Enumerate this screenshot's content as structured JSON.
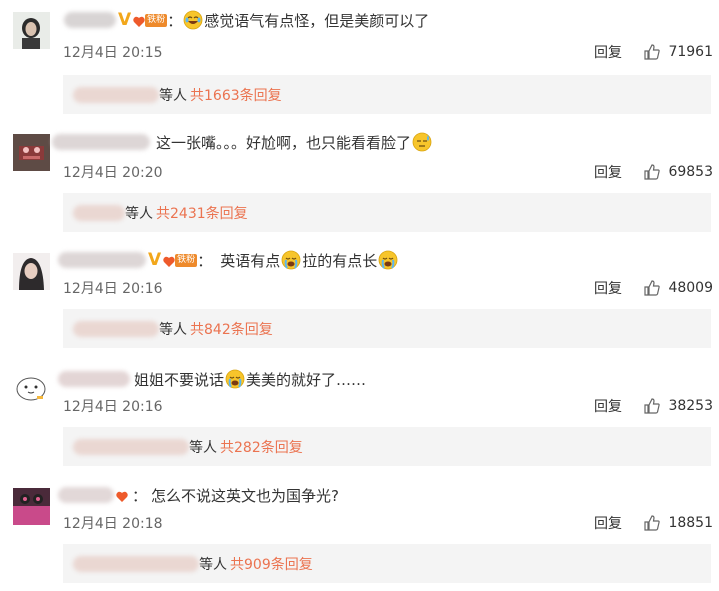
{
  "comments": [
    {
      "text": "：",
      "content": [
        "感觉语气有点怪，但是美颜可以了"
      ],
      "time": "12月4日 20:15",
      "reply_label": "回复",
      "likes": "71961",
      "reply_users_suffix": "等人",
      "reply_count": "共1663条回复",
      "fan_badge": "铁粉"
    },
    {
      "content": [
        "这一张嘴。。。好尬啊，也只能看看脸了"
      ],
      "time": "12月4日 20:20",
      "reply_label": "回复",
      "likes": "69853",
      "reply_users_suffix": "等人",
      "reply_count": "共2431条回复"
    },
    {
      "text": "：",
      "content": [
        "英语有点",
        "拉的有点长"
      ],
      "time": "12月4日 20:16",
      "reply_label": "回复",
      "likes": "48009",
      "reply_users_suffix": "等人",
      "reply_count": "共842条回复",
      "fan_badge": "铁粉"
    },
    {
      "content": [
        "姐姐不要说话",
        "美美的就好了……"
      ],
      "time": "12月4日 20:16",
      "reply_label": "回复",
      "likes": "38253",
      "reply_users_suffix": "等人",
      "reply_count": "共282条回复"
    },
    {
      "text": "：",
      "content": [
        "怎么不说这英文也为国争光?"
      ],
      "time": "12月4日 20:18",
      "reply_label": "回复",
      "likes": "18851",
      "reply_users_suffix": "等人",
      "reply_count": "共909条回复"
    }
  ],
  "colors": {
    "reply_count": "#eb7350",
    "reply_box_bg": "#f4f4f4",
    "v_badge": "#f2a71b",
    "fan_badge": "#ee8a2b"
  },
  "icons": [
    "like-thumb-icon",
    "laugh-cry-emoji",
    "sweat-emoji",
    "crying-emoji",
    "v-verified-badge",
    "fan-badge-icon"
  ]
}
